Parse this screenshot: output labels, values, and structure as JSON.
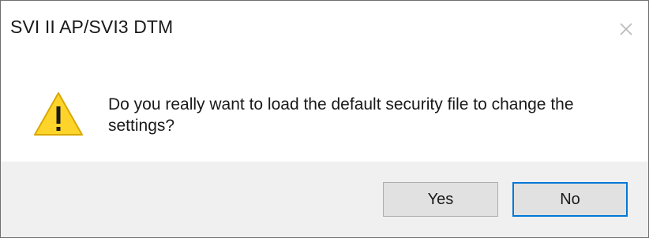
{
  "window": {
    "title": "SVI II AP/SVI3 DTM"
  },
  "message": {
    "icon": "warning-icon",
    "text": "Do you really want to load the default security file to change the settings?"
  },
  "buttons": {
    "yes_label": "Yes",
    "no_label": "No",
    "default": "No"
  },
  "colors": {
    "warning_fill": "#ffd42a",
    "focus_border": "#0078d7",
    "footer_bg": "#f0f0f0"
  }
}
